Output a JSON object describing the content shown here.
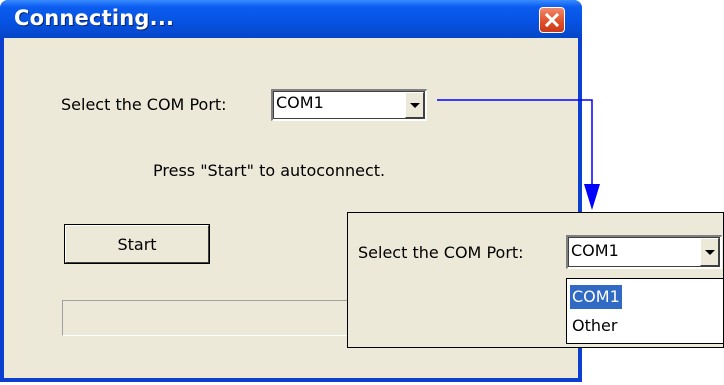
{
  "window": {
    "title": "Connecting...",
    "close_icon": "close-icon",
    "accent": "#0753e3",
    "close_color": "#e0522c"
  },
  "port_select": {
    "label": "Select the COM Port:",
    "value": "COM1"
  },
  "instruction": "Press \"Start\" to autoconnect.",
  "start_button": {
    "label": "Start"
  },
  "progress": {
    "value": 0
  },
  "callout": {
    "label": "Select the COM Port:",
    "value": "COM1",
    "options": [
      "COM1",
      "Other"
    ],
    "highlighted_option": "COM1",
    "highlight_color": "#316ac5",
    "arrow_color": "#0000ff"
  }
}
